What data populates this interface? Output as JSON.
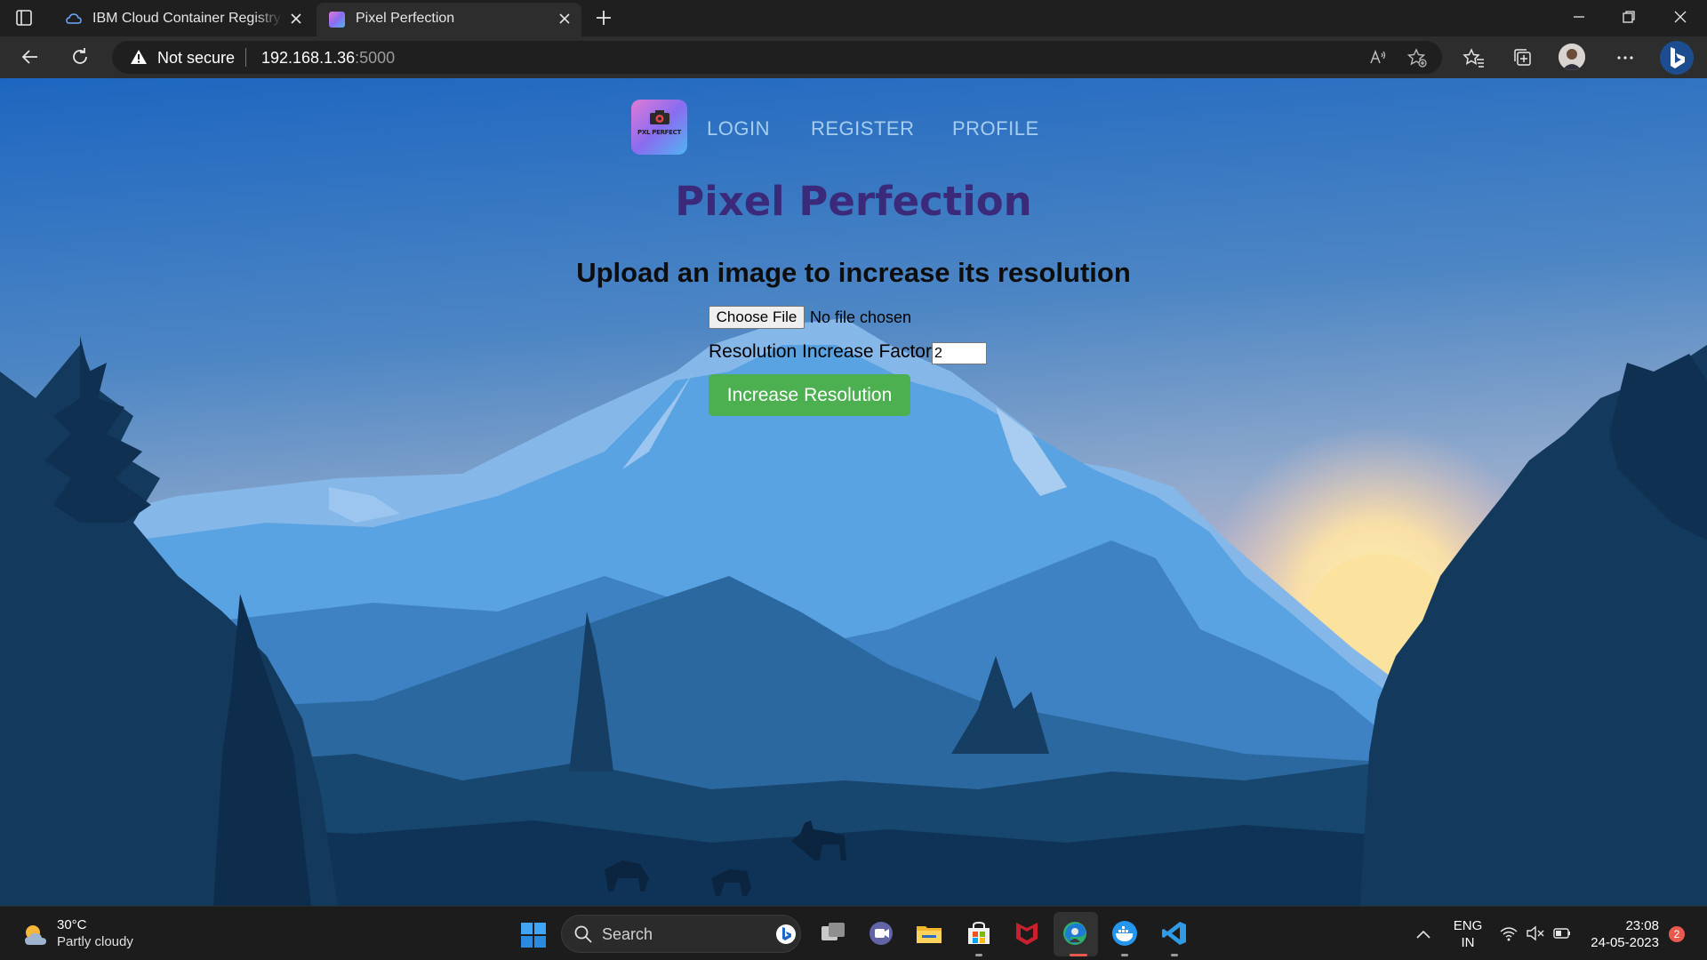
{
  "browser": {
    "tabs": [
      {
        "title": "IBM Cloud Container Registry - IBM",
        "active": false,
        "favicon": "ibm-cloud-icon"
      },
      {
        "title": "Pixel Perfection",
        "active": true,
        "favicon": "pixel-perfect-icon"
      }
    ],
    "address": {
      "security_label": "Not secure",
      "host": "192.168.1.36",
      "port": ":5000"
    }
  },
  "page": {
    "logo_text": "PXL PERFECT",
    "nav": {
      "login": "LOGIN",
      "register": "REGISTER",
      "profile": "PROFILE"
    },
    "title": "Pixel Perfection",
    "subtitle": "Upload an image to increase its resolution",
    "form": {
      "file_button": "Choose File",
      "file_status": "No file chosen",
      "factor_label": "Resolution Increase Factor:",
      "factor_value": "2",
      "submit_label": "Increase Resolution"
    },
    "colors": {
      "title": "#3b2a7a",
      "nav_link": "#a6cdf0",
      "submit": "#4caf50"
    }
  },
  "taskbar": {
    "weather": {
      "temp": "30°C",
      "desc": "Partly cloudy"
    },
    "search_placeholder": "Search",
    "lang_line1": "ENG",
    "lang_line2": "IN",
    "time": "23:08",
    "date": "24-05-2023",
    "notifications": "2"
  }
}
